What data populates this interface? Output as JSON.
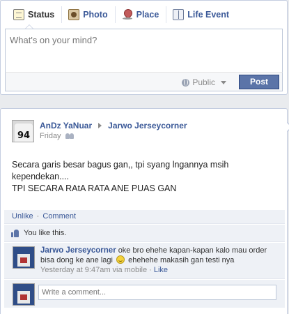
{
  "composer": {
    "tabs": [
      {
        "label": "Status",
        "icon": "status-icon"
      },
      {
        "label": "Photo",
        "icon": "photo-icon"
      },
      {
        "label": "Place",
        "icon": "place-icon"
      },
      {
        "label": "Life Event",
        "icon": "life-event-icon"
      }
    ],
    "placeholder": "What's on your mind?",
    "privacy_label": "Public",
    "post_label": "Post"
  },
  "story": {
    "author": "AnDz YaNuar",
    "target": "Jarwo Jerseycorner",
    "avatar_number": "94",
    "time": "Friday",
    "text_lines": [
      "Secara garis besar bagus gan,, tpi syang lngannya msih",
      "kependekan....",
      "TPI SECARA RAtA RATA ANE PUAS GAN"
    ],
    "actions": {
      "unlike": "Unlike",
      "separator": "·",
      "comment": "Comment"
    },
    "likes_text": "You like this.",
    "comment": {
      "author": "Jarwo Jerseycorner",
      "text_before": "oke bro ehehe kapan-kapan kalo mau order bisa dong ke ane lagi",
      "text_after": "ehehehe makasih gan testi nya",
      "meta": "Yesterday at 9:47am via mobile",
      "meta_sep": "·",
      "like_label": "Like"
    },
    "reply_placeholder": "Write a comment..."
  },
  "colors": {
    "link": "#3b5998",
    "post_button": "#5b74a8",
    "background": "#e9ebee"
  }
}
